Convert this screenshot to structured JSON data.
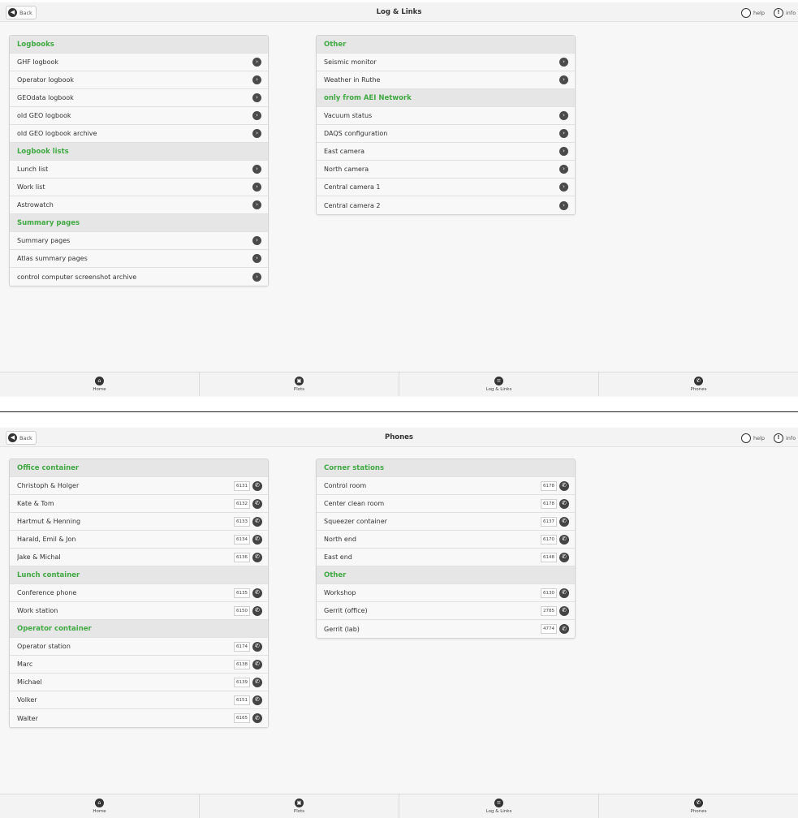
{
  "common": {
    "back_label": "Back",
    "help_label": "help",
    "info_label": "info"
  },
  "nav": [
    {
      "label": "Home",
      "icon": "home-icon"
    },
    {
      "label": "Plots",
      "icon": "camera-icon"
    },
    {
      "label": "Log & Links",
      "icon": "list-icon"
    },
    {
      "label": "Phones",
      "icon": "phone-icon"
    }
  ],
  "screen1": {
    "title": "Log & Links",
    "left_panel": {
      "logbooks_header": "Logbooks",
      "logbooks": [
        "GHF logbook",
        "Operator logbook",
        "GEOdata logbook",
        "old GEO logbook",
        "old GEO logbook archive"
      ],
      "lists_header": "Logbook lists",
      "lists": [
        "Lunch list",
        "Work list",
        "Astrowatch"
      ],
      "summary_header": "Summary pages",
      "summary": [
        "Summary pages",
        "Atlas summary pages",
        "control computer screenshot archive"
      ]
    },
    "right_panel": {
      "other_header": "Other",
      "other": [
        "Seismic monitor",
        "Weather in Ruthe"
      ],
      "aei_header": "only from AEI Network",
      "aei": [
        "Vacuum status",
        "DAQS configuration",
        "East camera",
        "North camera",
        "Central camera 1",
        "Central camera 2"
      ]
    }
  },
  "screen2": {
    "title": "Phones",
    "left_panel": {
      "office_header": "Office container",
      "office": [
        {
          "name": "Christoph & Holger",
          "ext": "6131"
        },
        {
          "name": "Kate & Tom",
          "ext": "6132"
        },
        {
          "name": "Hartmut & Henning",
          "ext": "6133"
        },
        {
          "name": "Harald, Emil & Jon",
          "ext": "6134"
        },
        {
          "name": "Jake & Michal",
          "ext": "6136"
        }
      ],
      "lunch_header": "Lunch container",
      "lunch": [
        {
          "name": "Conference phone",
          "ext": "6135"
        },
        {
          "name": "Work station",
          "ext": "6150"
        }
      ],
      "operator_header": "Operator container",
      "operator": [
        {
          "name": "Operator station",
          "ext": "6174"
        },
        {
          "name": "Marc",
          "ext": "6138"
        },
        {
          "name": "Michael",
          "ext": "6139"
        },
        {
          "name": "Volker",
          "ext": "6151"
        },
        {
          "name": "Walter",
          "ext": "6165"
        }
      ]
    },
    "right_panel": {
      "corner_header": "Corner stations",
      "corner": [
        {
          "name": "Control room",
          "ext": "6178"
        },
        {
          "name": "Center clean room",
          "ext": "6178"
        },
        {
          "name": "Squeezer container",
          "ext": "6137"
        },
        {
          "name": "North end",
          "ext": "6170"
        },
        {
          "name": "East end",
          "ext": "6148"
        }
      ],
      "other_header": "Other",
      "other": [
        {
          "name": "Workshop",
          "ext": "6130"
        },
        {
          "name": "Gerrit (office)",
          "ext": "2785"
        },
        {
          "name": "Gerrit (lab)",
          "ext": "4774"
        }
      ]
    }
  }
}
